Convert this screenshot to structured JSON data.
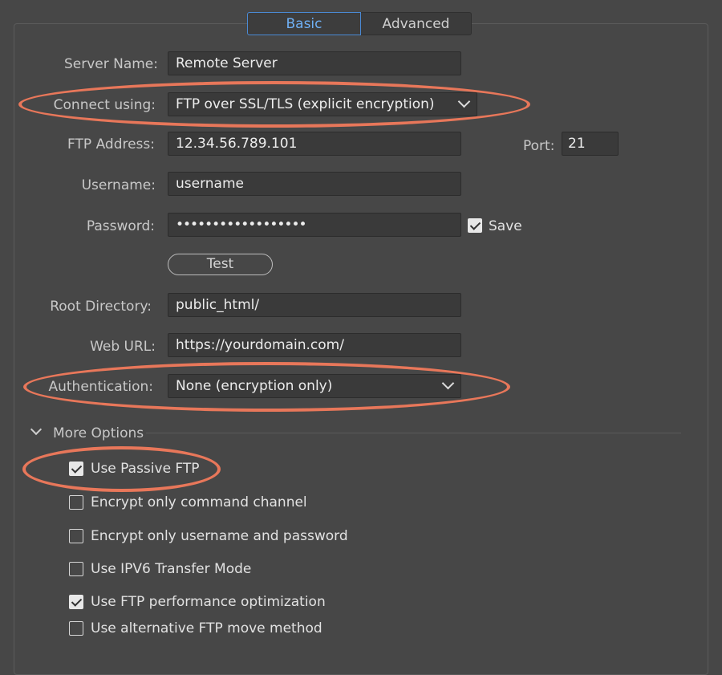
{
  "tabs": {
    "basic": "Basic",
    "advanced": "Advanced"
  },
  "form": {
    "server_name": {
      "label": "Server Name:",
      "value": "Remote Server"
    },
    "connect_using": {
      "label": "Connect using:",
      "value": "FTP over SSL/TLS (explicit encryption)"
    },
    "ftp_address": {
      "label": "FTP Address:",
      "value": "12.34.56.789.101"
    },
    "port": {
      "label": "Port:",
      "value": "21"
    },
    "username": {
      "label": "Username:",
      "value": "username"
    },
    "password": {
      "label": "Password:",
      "value": "••••••••••••••••••"
    },
    "save": {
      "label": "Save",
      "checked": true
    },
    "test_button": "Test",
    "root_directory": {
      "label": "Root Directory:",
      "value": "public_html/"
    },
    "web_url": {
      "label": "Web URL:",
      "value": "https://yourdomain.com/"
    },
    "authentication": {
      "label": "Authentication:",
      "value": "None (encryption only)"
    }
  },
  "more_options": {
    "title": "More Options",
    "items": [
      {
        "label": "Use Passive FTP",
        "checked": true
      },
      {
        "label": "Encrypt only command channel",
        "checked": false
      },
      {
        "label": "Encrypt only username and password",
        "checked": false
      },
      {
        "label": "Use IPV6 Transfer Mode",
        "checked": false
      },
      {
        "label": "Use FTP performance optimization",
        "checked": true
      },
      {
        "label": "Use alternative FTP move method",
        "checked": false
      }
    ]
  },
  "colors": {
    "background": "#474747",
    "accent": "#4a8ad4",
    "annotation": "#e8775a"
  }
}
